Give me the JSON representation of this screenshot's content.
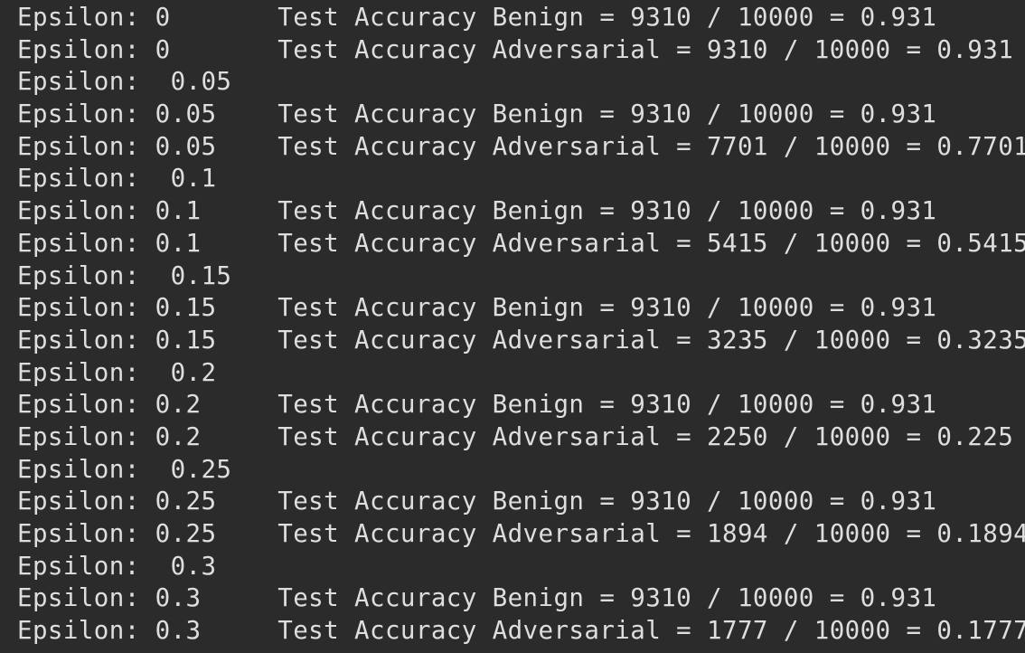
{
  "terminal": {
    "background": "#2b2b2b",
    "foreground": "#dedede",
    "lines": [
      "Epsilon: 0       Test Accuracy Benign = 9310 / 10000 = 0.931",
      "Epsilon: 0       Test Accuracy Adversarial = 9310 / 10000 = 0.931",
      "Epsilon:  0.05",
      "Epsilon: 0.05    Test Accuracy Benign = 9310 / 10000 = 0.931",
      "Epsilon: 0.05    Test Accuracy Adversarial = 7701 / 10000 = 0.7701",
      "Epsilon:  0.1",
      "Epsilon: 0.1     Test Accuracy Benign = 9310 / 10000 = 0.931",
      "Epsilon: 0.1     Test Accuracy Adversarial = 5415 / 10000 = 0.5415",
      "Epsilon:  0.15",
      "Epsilon: 0.15    Test Accuracy Benign = 9310 / 10000 = 0.931",
      "Epsilon: 0.15    Test Accuracy Adversarial = 3235 / 10000 = 0.3235",
      "Epsilon:  0.2",
      "Epsilon: 0.2     Test Accuracy Benign = 9310 / 10000 = 0.931",
      "Epsilon: 0.2     Test Accuracy Adversarial = 2250 / 10000 = 0.225",
      "Epsilon:  0.25",
      "Epsilon: 0.25    Test Accuracy Benign = 9310 / 10000 = 0.931",
      "Epsilon: 0.25    Test Accuracy Adversarial = 1894 / 10000 = 0.1894",
      "Epsilon:  0.3",
      "Epsilon: 0.3     Test Accuracy Benign = 9310 / 10000 = 0.931",
      "Epsilon: 0.3     Test Accuracy Adversarial = 1777 / 10000 = 0.1777"
    ]
  }
}
